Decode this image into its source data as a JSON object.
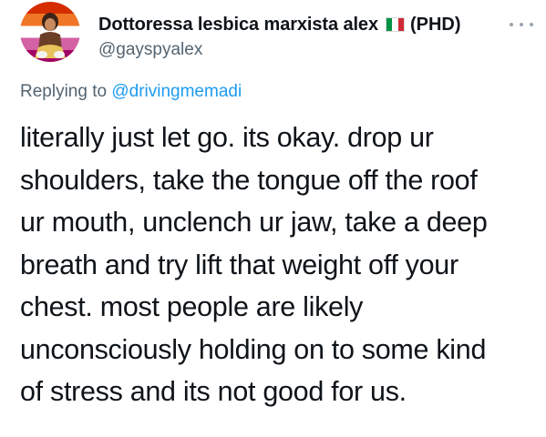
{
  "tweet": {
    "author": {
      "display_name": "Dottoressa lesbica marxista alex",
      "flag_icon": "italy-flag-icon",
      "name_suffix": "(PHD)",
      "handle": "@gayspyalex",
      "avatar_colors": [
        "#d52d00",
        "#ef7627",
        "#ffffff",
        "#d362a4",
        "#a30262"
      ]
    },
    "more_icon": "more-options-icon",
    "reply": {
      "prefix": "Replying to",
      "mention": "@drivingmemadi"
    },
    "text_lines": [
      "literally just let go. its okay. drop ur",
      "shoulders, take the tongue off the roof",
      "ur mouth, unclench ur jaw, take a deep",
      "breath and try lift that weight off your",
      "chest. most people are likely",
      "unconsciously holding on to some kind",
      "of stress and its not good for us."
    ],
    "colors": {
      "text": "#0f1419",
      "secondary": "#536471",
      "link": "#1d9bf0"
    }
  }
}
